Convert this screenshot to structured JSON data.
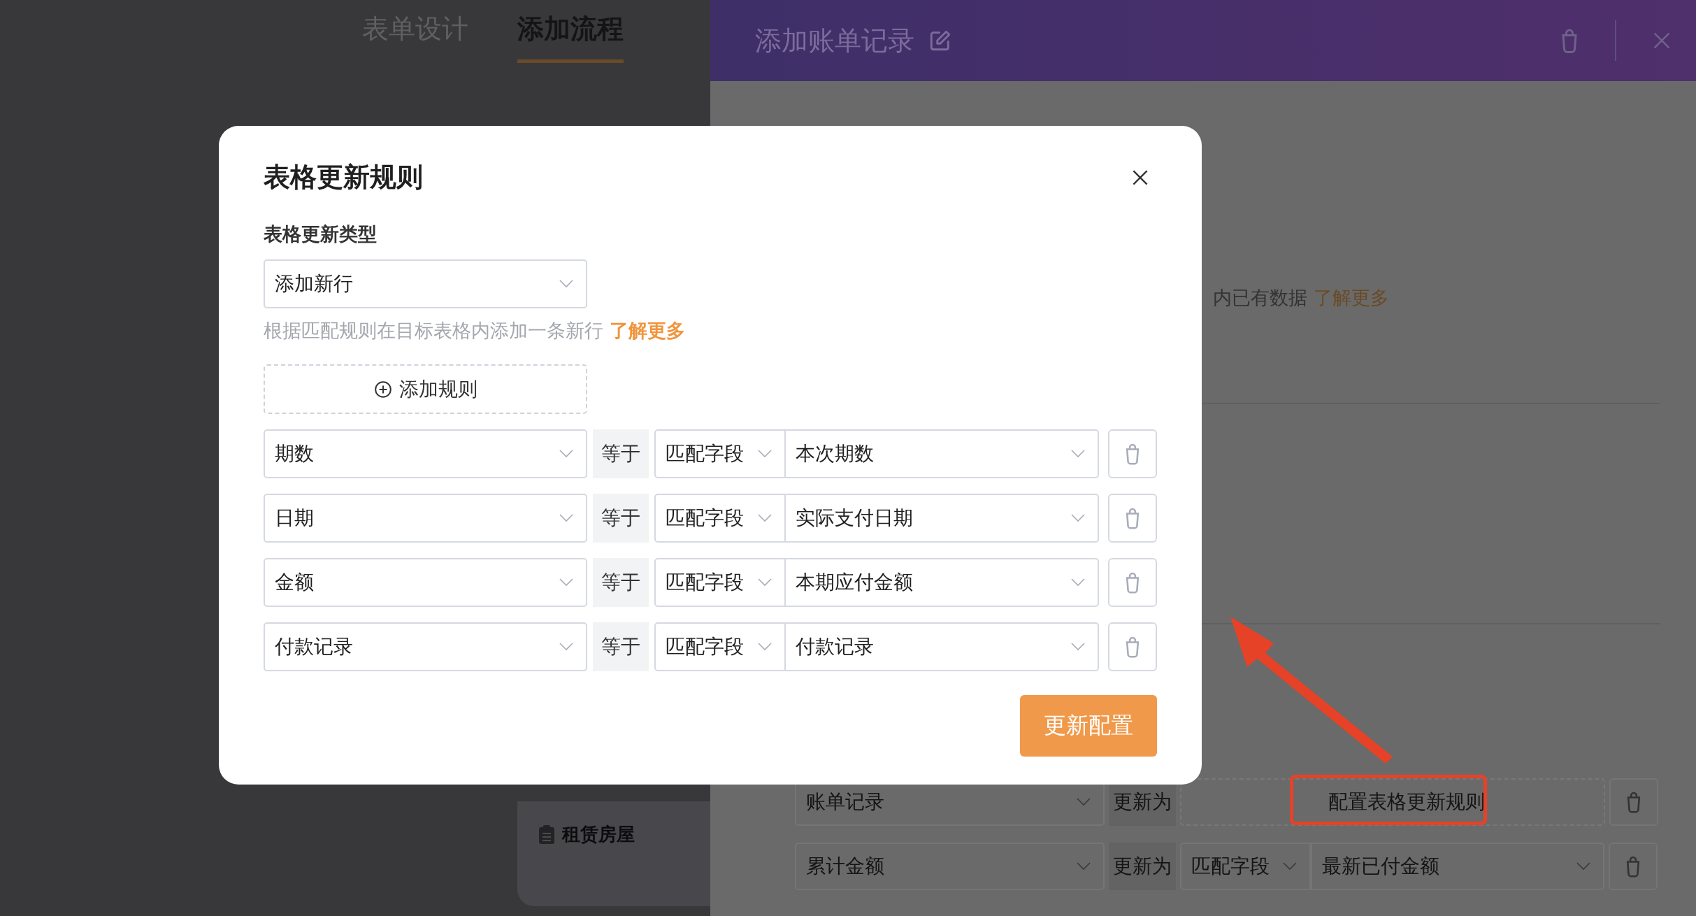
{
  "page_tabs": [
    {
      "label": "表单设计",
      "selected": false
    },
    {
      "label": "添加流程",
      "selected": true
    }
  ],
  "flow_card": {
    "title": "租赁房屋"
  },
  "drawer": {
    "title": "添加账单记录",
    "hint_text": "内已有数据",
    "hint_link": "了解更多",
    "update_rows": [
      {
        "kind": "rule",
        "field": "账单记录",
        "operator": "更新为",
        "action": "配置表格更新规则"
      },
      {
        "kind": "match",
        "field": "累计金额",
        "operator": "更新为",
        "source": "匹配字段",
        "value": "最新已付金额"
      }
    ]
  },
  "dialog": {
    "title": "表格更新规则",
    "type_label": "表格更新类型",
    "type_value": "添加新行",
    "help_text": "根据匹配规则在目标表格内添加一条新行",
    "help_link": "了解更多",
    "add_rule": "添加规则",
    "rules": [
      {
        "field": "期数",
        "operator": "等于",
        "source": "匹配字段",
        "value": "本次期数"
      },
      {
        "field": "日期",
        "operator": "等于",
        "source": "匹配字段",
        "value": "实际支付日期"
      },
      {
        "field": "金额",
        "operator": "等于",
        "source": "匹配字段",
        "value": "本期应付金额"
      },
      {
        "field": "付款记录",
        "operator": "等于",
        "source": "匹配字段",
        "value": "付款记录"
      }
    ],
    "submit": "更新配置"
  }
}
